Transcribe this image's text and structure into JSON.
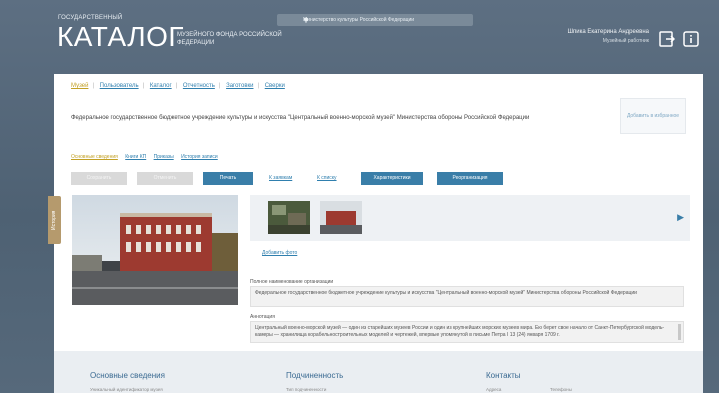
{
  "header": {
    "gos": "ГОСУДАРСТВЕННЫЙ",
    "catalog": "КАТАЛОГ",
    "subtitle": "МУЗЕЙНОГО ФОНДА РОССИЙСКОЙ ФЕДЕРАЦИИ",
    "ministry": "Министерство культуры Российской Федерации",
    "user_name": "Шпика Екатерина Андреевна",
    "user_role": "Музейный работник"
  },
  "tabs": [
    {
      "label": "Музей",
      "active": true
    },
    {
      "label": "Пользователь",
      "active": false
    },
    {
      "label": "Каталог",
      "active": false
    },
    {
      "label": "Отчетность",
      "active": false
    },
    {
      "label": "Заготовки",
      "active": false
    },
    {
      "label": "Сверки",
      "active": false
    }
  ],
  "organization": {
    "title": "Федеральное государственное бюджетное учреждение культуры и искусства \"Центральный военно-морской музей\" Министерства обороны Российской Федерации",
    "add_favorite": "Добавить в избранное"
  },
  "subtabs": [
    {
      "label": "Основные сведения",
      "active": true
    },
    {
      "label": "Книги КП",
      "active": false
    },
    {
      "label": "Приказы",
      "active": false
    },
    {
      "label": "История записи",
      "active": false
    }
  ],
  "toolbar": {
    "btn1": "Сохранить",
    "btn2": "Отменить",
    "print": "Печать",
    "link1": "К заявкам",
    "link2": "К списку",
    "characteristics": "Характеристики",
    "reorganization": "Реорганизация"
  },
  "history_tab": "История",
  "photo": {
    "add_photo": "Добавить фото"
  },
  "fields": {
    "full_name_label": "Полное наименование организации",
    "full_name_value": "Федеральное государственное бюджетное учреждение культуры и искусства \"Центральный военно-морской музей\" Министерства обороны Российской Федерации",
    "annotation_label": "Аннотация",
    "annotation_value": "Центральный военно-морской музей — один из старейших музеев России и один из крупнейших морских музеев мира. Ею берет свое начало от Санкт-Петербургской модель-камеры — хранилища корабельностроительных моделей и чертежей, впервые упомянутой в письме Петра I 13 (24) января 1709 г."
  },
  "sections": {
    "main": "Основные сведения",
    "main_sub": "Уникальный идентификатор музея",
    "subordination": "Подчиненность",
    "subordination_sub": "Тип подчиненности",
    "contacts": "Контакты",
    "contacts_sub1": "Адреса",
    "contacts_sub2": "Телефоны"
  },
  "colors": {
    "header_bg": "#56697b",
    "accent_blue": "#3a7ea8",
    "tab_active": "#c2a024",
    "history_tab": "#b59a6d"
  }
}
